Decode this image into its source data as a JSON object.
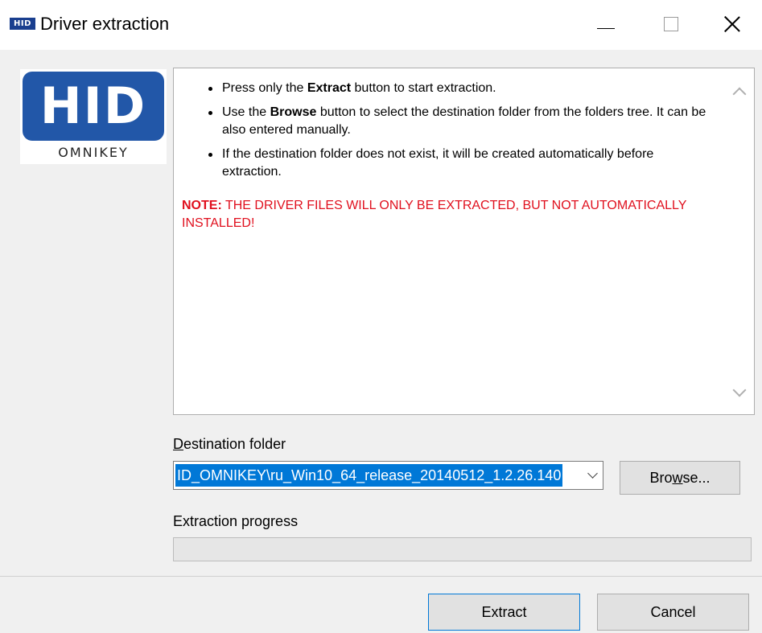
{
  "window": {
    "app_icon_text": "HID",
    "title": "Driver extraction",
    "controls": {
      "minimize_icon": "minimize-icon",
      "maximize_icon": "maximize-icon",
      "close_icon": "close-icon"
    }
  },
  "logo": {
    "brand": "HID",
    "subtitle": "OMNIKEY",
    "brand_color": "#2257a8"
  },
  "info": {
    "bullets": [
      {
        "before": "Press only the ",
        "bold": "Extract",
        "after": " button to start extraction."
      },
      {
        "before": "Use the ",
        "bold": "Browse",
        "after": " button to select the destination folder from the folders tree. It can be also entered manually."
      },
      {
        "before": "If the destination folder does not exist, it will be created automatically before extraction.",
        "bold": "",
        "after": ""
      }
    ],
    "note_label": "NOTE:",
    "note_text": " THE DRIVER FILES WILL ONLY BE EXTRACTED, BUT NOT AUTOMATICALLY INSTALLED!",
    "note_color": "#e0101e"
  },
  "destination": {
    "label_underlined": "D",
    "label_rest": "estination folder",
    "value": "ID_OMNIKEY\\ru_Win10_64_release_20140512_1.2.26.140",
    "browse_prefix": "Bro",
    "browse_underlined": "w",
    "browse_suffix": "se..."
  },
  "progress": {
    "label": "Extraction progress",
    "value_fraction": 0
  },
  "buttons": {
    "extract": "Extract",
    "cancel": "Cancel"
  }
}
